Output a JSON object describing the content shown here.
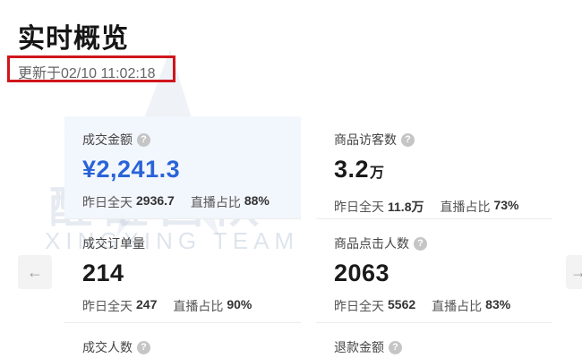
{
  "page": {
    "title": "实时概览",
    "updated": "更新于02/10 11:02:18"
  },
  "watermark": {
    "cn": "醒醒团队",
    "en": "XINGXING TEAM"
  },
  "icons": {
    "help": "?",
    "prev": "←",
    "next": "→"
  },
  "metrics": [
    {
      "label": "成交金额",
      "value": "¥2,241.3",
      "unit": "",
      "yesterday_label": "昨日全天",
      "yesterday_value": "2936.7",
      "live_label": "直播占比",
      "live_value": "88%"
    },
    {
      "label": "商品访客数",
      "value": "3.2",
      "unit": "万",
      "yesterday_label": "昨日全天",
      "yesterday_value": "11.8万",
      "live_label": "直播占比",
      "live_value": "73%"
    },
    {
      "label": "成交订单量",
      "value": "214",
      "unit": "",
      "yesterday_label": "昨日全天",
      "yesterday_value": "247",
      "live_label": "直播占比",
      "live_value": "90%"
    },
    {
      "label": "商品点击人数",
      "value": "2063",
      "unit": "",
      "yesterday_label": "昨日全天",
      "yesterday_value": "5562",
      "live_label": "直播占比",
      "live_value": "83%"
    },
    {
      "label": "成交人数",
      "value": "",
      "unit": "",
      "yesterday_label": "",
      "yesterday_value": "",
      "live_label": "",
      "live_value": ""
    },
    {
      "label": "退款金额",
      "value": "",
      "unit": "",
      "yesterday_label": "",
      "yesterday_value": "",
      "live_label": "",
      "live_value": ""
    }
  ],
  "colors": {
    "accent": "#2a63d8",
    "highlight": "#d0161c"
  }
}
